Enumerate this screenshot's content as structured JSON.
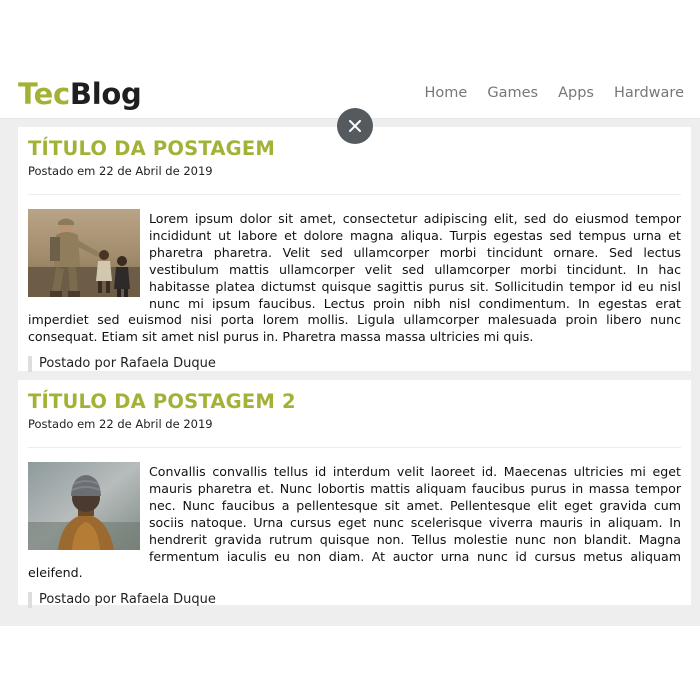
{
  "header": {
    "logo_part1": "Tec",
    "logo_part2": "Blog",
    "nav": [
      "Home",
      "Games",
      "Apps",
      "Hardware"
    ]
  },
  "close_label": "×",
  "posts": [
    {
      "title": "TÍTULO DA POSTAGEM",
      "date": "Postado em 22 de Abril de 2019",
      "image": "soldier-child-photo",
      "body": "Lorem ipsum dolor sit amet, consectetur adipiscing elit, sed do eiusmod tempor incididunt ut labore et dolore magna aliqua. Turpis egestas sed tempus urna et pharetra pharetra. Velit sed ullamcorper morbi tincidunt ornare. Sed lectus vestibulum mattis ullamcorper velit sed ullamcorper morbi tincidunt. In hac habitasse platea dictumst quisque sagittis purus sit. Sollicitudin tempor id eu nisl nunc mi ipsum faucibus. Lectus proin nibh nisl condimentum. In egestas erat imperdiet sed euismod nisi porta lorem mollis. Ligula ullamcorper malesuada proin libero nunc consequat. Etiam sit amet nisl purus in. Pharetra massa massa ultricies mi quis.",
      "author": "Postado por Rafaela Duque"
    },
    {
      "title": "TÍTULO DA POSTAGEM 2",
      "date": "Postado em 22 de Abril de 2019",
      "image": "person-beanie-photo",
      "body": "Convallis convallis tellus id interdum velit laoreet id. Maecenas ultricies mi eget mauris pharetra et. Nunc lobortis mattis aliquam faucibus purus in massa tempor nec. Nunc faucibus a pellentesque sit amet. Pellentesque elit eget gravida cum sociis natoque. Urna cursus eget nunc scelerisque viverra mauris in aliquam. In hendrerit gravida rutrum quisque non. Tellus molestie nunc non blandit. Magna fermentum iaculis eu non diam. At auctor urna nunc id cursus metus aliquam eleifend.",
      "author": "Postado por Rafaela Duque"
    }
  ],
  "colors": {
    "accent": "#a3b237",
    "logo_dark": "#1f1f1f",
    "nav_text": "#777777",
    "close_bg": "#555a5e",
    "content_bg": "#eeeeee"
  }
}
